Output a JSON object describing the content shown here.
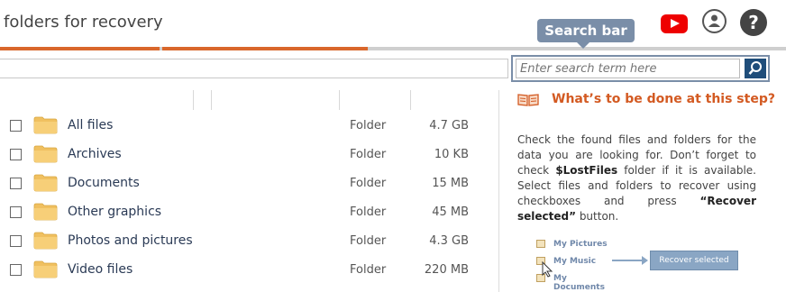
{
  "header": {
    "title": "folders for recovery",
    "icons": [
      "youtube-icon",
      "user-icon",
      "help-icon"
    ],
    "help_glyph": "?"
  },
  "progress": {
    "completed_steps": 2,
    "total_steps": 3,
    "accent": "#d9672b"
  },
  "tooltip": {
    "label": "Search bar"
  },
  "search": {
    "placeholder": "Enter search term here",
    "value": ""
  },
  "files": {
    "rows": [
      {
        "name": "All files",
        "type": "Folder",
        "size": "4.7 GB"
      },
      {
        "name": "Archives",
        "type": "Folder",
        "size": "10 KB"
      },
      {
        "name": "Documents",
        "type": "Folder",
        "size": "15 MB"
      },
      {
        "name": "Other graphics",
        "type": "Folder",
        "size": "45 MB"
      },
      {
        "name": "Photos and pictures",
        "type": "Folder",
        "size": "4.3 GB"
      },
      {
        "name": "Video files",
        "type": "Folder",
        "size": "220 MB"
      }
    ]
  },
  "help": {
    "title": "What’s to be done at this step?",
    "text_1": "Check the found files and folders for the data you are looking for. Don’t forget to check ",
    "text_bold_1": "$LostFiles",
    "text_2": " folder if it is available. Select files and folders to recover using checkboxes and press ",
    "text_bold_2": "“Recover selected”",
    "text_3": " button.",
    "illustration": {
      "items": [
        "My Pictures",
        "My Music",
        "My Documents"
      ],
      "button": "Recover selected"
    }
  }
}
